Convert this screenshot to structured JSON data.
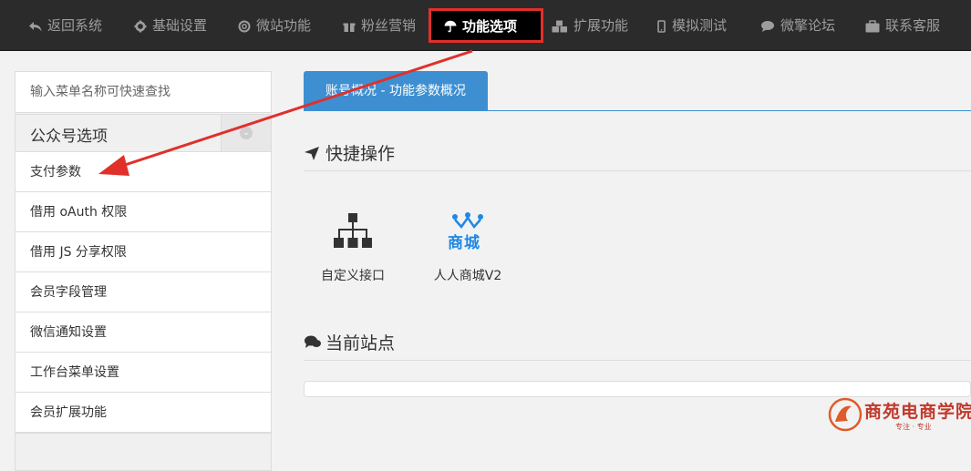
{
  "topnav": {
    "items": [
      {
        "label": "返回系统",
        "icon": "reply-icon"
      },
      {
        "label": "基础设置",
        "icon": "gear-icon"
      },
      {
        "label": "微站功能",
        "icon": "lifebuoy-icon"
      },
      {
        "label": "粉丝营销",
        "icon": "gift-icon"
      },
      {
        "label": "功能选项",
        "icon": "umbrella-icon",
        "active": true
      },
      {
        "label": "扩展功能",
        "icon": "cubes-icon"
      },
      {
        "label": "模拟测试",
        "icon": "mobile-icon"
      },
      {
        "label": "微擎论坛",
        "icon": "comment-icon"
      },
      {
        "label": "联系客服",
        "icon": "briefcase-icon"
      }
    ]
  },
  "sidebar": {
    "search_placeholder": "输入菜单名称可快速查找",
    "group_title": "公众号选项",
    "items": [
      {
        "label": "支付参数"
      },
      {
        "label": "借用 oAuth 权限"
      },
      {
        "label": "借用 JS 分享权限"
      },
      {
        "label": "会员字段管理"
      },
      {
        "label": "微信通知设置"
      },
      {
        "label": "工作台菜单设置"
      },
      {
        "label": "会员扩展功能"
      }
    ]
  },
  "main": {
    "tab_label": "账号概况 - 功能参数概况",
    "quick_title": "快捷操作",
    "shortcuts": [
      {
        "label": "自定义接口",
        "icon": "sitemap-icon"
      },
      {
        "label": "人人商城V2",
        "icon": "shop-logo",
        "logo_text": "商城"
      }
    ],
    "sites_title": "当前站点"
  },
  "watermark": {
    "text": "商苑电商学院",
    "sub": "专注 · 专业"
  },
  "colors": {
    "accent": "#3d8fd1",
    "highlight": "#e0302a",
    "topbar": "#2b2b2b"
  }
}
